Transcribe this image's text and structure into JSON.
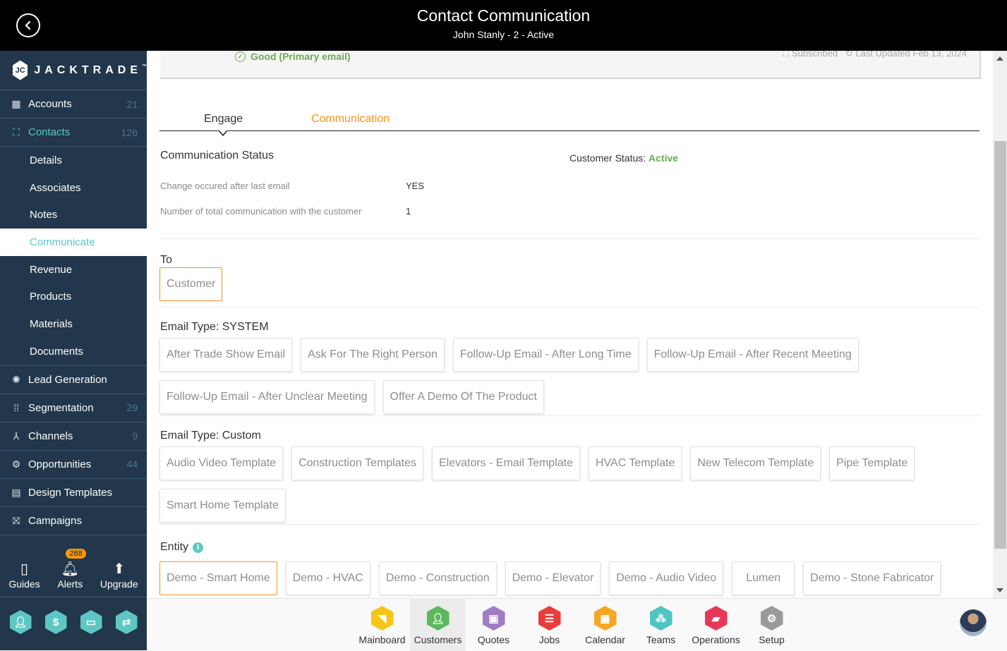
{
  "header": {
    "title": "Contact Communication",
    "subtitle": "John Stanly - 2 - Active",
    "back_icon": "chevron-left-circle-icon"
  },
  "sidebar": {
    "brand": "JACKTRADE",
    "brand_tm": "™",
    "items": [
      {
        "label": "Accounts",
        "count": "21",
        "icon": "building-icon"
      },
      {
        "label": "Contacts",
        "count": "126",
        "icon": "contacts-icon",
        "active": true
      }
    ],
    "sub_items": [
      "Details",
      "Associates",
      "Notes",
      "Communicate",
      "Revenue",
      "Products",
      "Materials",
      "Documents"
    ],
    "selected_sub": "Communicate",
    "items_after": [
      {
        "label": "Lead Generation",
        "count": "",
        "icon": "lead-generation-icon"
      },
      {
        "label": "Segmentation",
        "count": "29",
        "icon": "segmentation-icon"
      },
      {
        "label": "Channels",
        "count": "9",
        "icon": "channels-icon"
      },
      {
        "label": "Opportunities",
        "count": "44",
        "icon": "opportunities-icon"
      },
      {
        "label": "Design Templates",
        "count": "",
        "icon": "design-templates-icon"
      },
      {
        "label": "Campaigns",
        "count": "",
        "icon": "campaigns-icon"
      }
    ],
    "utilities": [
      {
        "label": "Guides",
        "icon": "book-icon"
      },
      {
        "label": "Alerts",
        "icon": "bell-icon",
        "badge": "268"
      },
      {
        "label": "Upgrade",
        "icon": "arrow-up-icon"
      }
    ],
    "quick_icons": [
      "person-icon",
      "dollar-icon",
      "money-icon",
      "workflow-icon"
    ]
  },
  "card": {
    "email_status": "Good (Primary email)",
    "subscribed": "Subscribed",
    "last_updated": "Last Updated Feb 13, 2024"
  },
  "tabs": [
    {
      "label": "Engage",
      "active": true
    },
    {
      "label": "Communication",
      "active": false
    }
  ],
  "status": {
    "heading": "Communication Status",
    "customer_status_label": "Customer Status:",
    "customer_status_value": "Active",
    "rows": [
      {
        "label": "Change occured after last email",
        "value": "YES"
      },
      {
        "label": "Number of total communication with the customer",
        "value": "1"
      }
    ]
  },
  "to": {
    "label": "To",
    "options": [
      {
        "label": "Customer",
        "selected": true
      }
    ]
  },
  "system_templates": {
    "label": "Email Type: SYSTEM",
    "options": [
      "After Trade Show Email",
      "Ask For The Right Person",
      "Follow-Up Email - After Long Time",
      "Follow-Up Email - After Recent Meeting",
      "Follow-Up Email - After Unclear Meeting",
      "Offer A Demo Of The Product"
    ]
  },
  "custom_templates": {
    "label": "Email Type: Custom",
    "options": [
      "Audio Video Template",
      "Construction Templates",
      "Elevators - Email Template",
      "HVAC Template",
      "New Telecom Template",
      "Pipe Template",
      "Smart Home Template"
    ]
  },
  "entity": {
    "label": "Entity",
    "options": [
      {
        "label": "Demo - Smart Home",
        "selected": true
      },
      {
        "label": "Demo - HVAC"
      },
      {
        "label": "Demo - Construction"
      },
      {
        "label": "Demo - Elevator"
      },
      {
        "label": "Demo - Audio Video"
      },
      {
        "label": "Lumen"
      },
      {
        "label": "Demo - Stone Fabricator"
      }
    ]
  },
  "bottom_apps": [
    {
      "label": "Mainboard",
      "color": "#f5c518",
      "icon": "mainboard-icon"
    },
    {
      "label": "Customers",
      "color": "#5cb85c",
      "icon": "customer-icon",
      "active": true
    },
    {
      "label": "Quotes",
      "color": "#a07cc5",
      "icon": "quotes-icon"
    },
    {
      "label": "Jobs",
      "color": "#ea3c3c",
      "icon": "jobs-icon"
    },
    {
      "label": "Calendar",
      "color": "#f5a623",
      "icon": "calendar-icon"
    },
    {
      "label": "Teams",
      "color": "#4fc4c0",
      "icon": "teams-icon"
    },
    {
      "label": "Operations",
      "color": "#e8385a",
      "icon": "operations-icon"
    },
    {
      "label": "Setup",
      "color": "#9a9a9a",
      "icon": "gear-icon"
    }
  ],
  "colors": {
    "accent": "#f7931e",
    "teal": "#5ec7c3",
    "sidebar_bg": "#22374b",
    "success": "#6aad4f"
  }
}
